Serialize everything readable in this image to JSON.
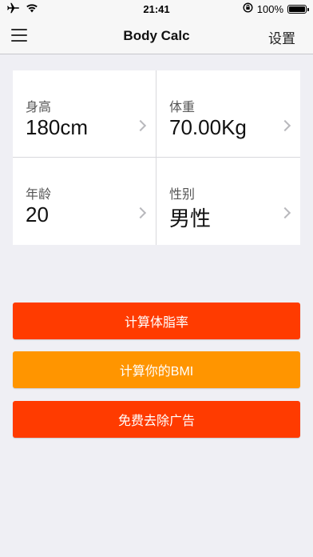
{
  "status_bar": {
    "time": "21:41",
    "battery": "100%",
    "icons": [
      "airplane-icon",
      "wifi-icon",
      "orientation-lock-icon",
      "battery-icon"
    ]
  },
  "nav": {
    "title": "Body Calc",
    "settings_label": "设置",
    "menu_icon": "hamburger-menu-icon"
  },
  "fields": {
    "height": {
      "label": "身高",
      "value": "180cm"
    },
    "weight": {
      "label": "体重",
      "value": "70.00Kg"
    },
    "age": {
      "label": "年龄",
      "value": "20"
    },
    "gender": {
      "label": "性别",
      "value": "男性"
    }
  },
  "buttons": {
    "body_fat": {
      "label": "计算体脂率",
      "color": "#ff3b00"
    },
    "bmi": {
      "label": "计算你的BMI",
      "color": "#ff9500"
    },
    "remove_ads": {
      "label": "免费去除广告",
      "color": "#ff3b00"
    }
  },
  "colors": {
    "background": "#efeff4",
    "nav_background": "#f7f7f7",
    "accent_red": "#ff3b00",
    "accent_orange": "#ff9500"
  }
}
